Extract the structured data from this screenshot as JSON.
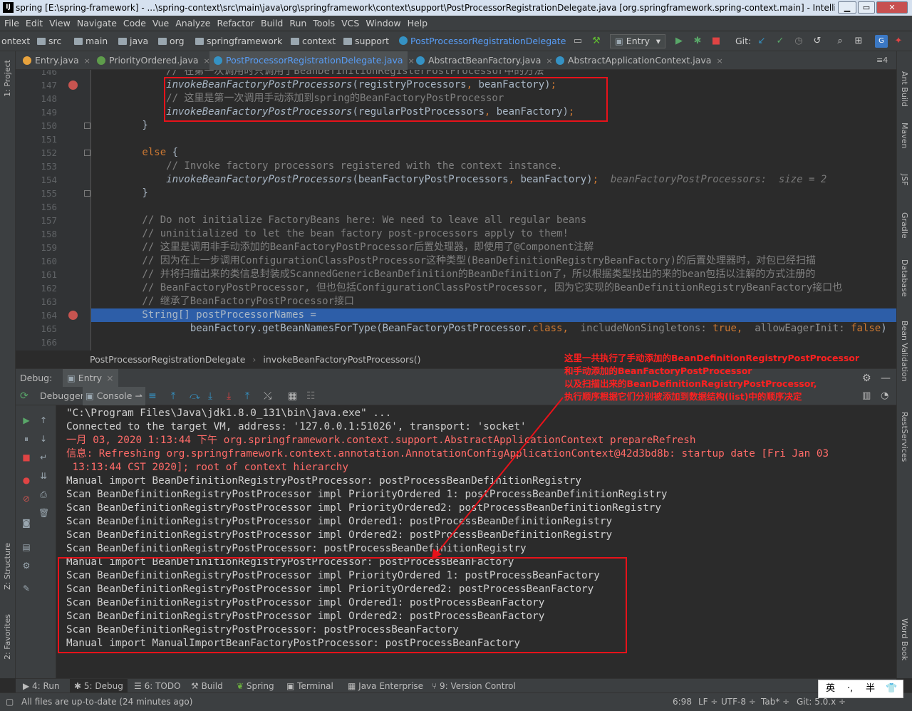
{
  "window": {
    "title": "spring [E:\\spring-framework] - ...\\spring-context\\src\\main\\java\\org\\springframework\\context\\support\\PostProcessorRegistrationDelegate.java [org.springframework.spring-context.main] - IntelliJ IDE...",
    "app_icon": "IJ"
  },
  "menu": [
    "File",
    "Edit",
    "View",
    "Navigate",
    "Code",
    "Vue",
    "Analyze",
    "Refactor",
    "Build",
    "Run",
    "Tools",
    "VCS",
    "Window",
    "Help"
  ],
  "nav": {
    "crumbs": [
      "ontext",
      "src",
      "main",
      "java",
      "org",
      "springframework",
      "context",
      "support",
      "PostProcessorRegistrationDelegate"
    ],
    "run_config": "Entry",
    "git_label": "Git:"
  },
  "tabs": [
    {
      "label": "Entry.java",
      "icon_color": "#e8a33d",
      "active": false
    },
    {
      "label": "PriorityOrdered.java",
      "icon_color": "#5e9c4b",
      "active": false
    },
    {
      "label": "PostProcessorRegistrationDelegate.java",
      "icon_color": "#3592c4",
      "active": true
    },
    {
      "label": "AbstractBeanFactory.java",
      "icon_color": "#3592c4",
      "active": false
    },
    {
      "label": "AbstractApplicationContext.java",
      "icon_color": "#3592c4",
      "active": false
    }
  ],
  "tab_overflow": "≡4",
  "left_tools": [
    "1: Project",
    "Z: Structure",
    "2: Favorites"
  ],
  "right_tools": [
    "Ant Build",
    "Maven",
    "JSF",
    "Gradle",
    "Database",
    "Bean Validation",
    "RestServices",
    "Word Book"
  ],
  "editor": {
    "lines": [
      {
        "n": "146",
        "segs": [
          {
            "c": "cm",
            "t": "            // 在第一次调用时只调用了BeanDefinitionRegisterPostProcessor中的方法"
          }
        ]
      },
      {
        "n": "147",
        "bp": true,
        "segs": [
          {
            "c": "fn",
            "t": "            invokeBeanFactoryPostProcessors"
          },
          {
            "c": "",
            "t": "(registryProcessors"
          },
          {
            "c": "kw",
            "t": ", "
          },
          {
            "c": "",
            "t": "beanFactory)"
          },
          {
            "c": "kw",
            "t": ";"
          }
        ]
      },
      {
        "n": "148",
        "segs": [
          {
            "c": "cm",
            "t": "            // 这里是第一次调用手动添加到spring的BeanFactoryPostProcessor"
          }
        ]
      },
      {
        "n": "149",
        "segs": [
          {
            "c": "fn",
            "t": "            invokeBeanFactoryPostProcessors"
          },
          {
            "c": "",
            "t": "(regularPostProcessors"
          },
          {
            "c": "kw",
            "t": ", "
          },
          {
            "c": "",
            "t": "beanFactory)"
          },
          {
            "c": "kw",
            "t": ";"
          }
        ]
      },
      {
        "n": "150",
        "segs": [
          {
            "c": "",
            "t": "        }"
          }
        ]
      },
      {
        "n": "151",
        "segs": [
          {
            "c": "",
            "t": ""
          }
        ]
      },
      {
        "n": "152",
        "segs": [
          {
            "c": "kw",
            "t": "        else "
          },
          {
            "c": "",
            "t": "{"
          }
        ]
      },
      {
        "n": "153",
        "segs": [
          {
            "c": "cm",
            "t": "            // Invoke factory processors registered with the context instance."
          }
        ]
      },
      {
        "n": "154",
        "segs": [
          {
            "c": "fn",
            "t": "            invokeBeanFactoryPostProcessors"
          },
          {
            "c": "",
            "t": "(beanFactoryPostProcessors"
          },
          {
            "c": "kw",
            "t": ", "
          },
          {
            "c": "",
            "t": "beanFactory)"
          },
          {
            "c": "kw",
            "t": ";"
          },
          {
            "c": "hint",
            "t": "  beanFactoryPostProcessors:  size = 2"
          }
        ]
      },
      {
        "n": "155",
        "segs": [
          {
            "c": "",
            "t": "        }"
          }
        ]
      },
      {
        "n": "156",
        "segs": [
          {
            "c": "",
            "t": ""
          }
        ]
      },
      {
        "n": "157",
        "segs": [
          {
            "c": "cm",
            "t": "        // Do not initialize FactoryBeans here: We need to leave all regular beans"
          }
        ]
      },
      {
        "n": "158",
        "segs": [
          {
            "c": "cm",
            "t": "        // uninitialized to let the bean factory post-processors apply to them!"
          }
        ]
      },
      {
        "n": "159",
        "segs": [
          {
            "c": "cm",
            "t": "        // 这里是调用非手动添加的BeanFactoryPostProcessor后置处理器，即使用了@Component注解"
          }
        ]
      },
      {
        "n": "160",
        "segs": [
          {
            "c": "cm",
            "t": "        // 因为在上一步调用ConfigurationClassPostProcessor这种类型(BeanDefinitionRegistryBeanFactory)的后置处理器时，对包已经扫描"
          }
        ]
      },
      {
        "n": "161",
        "segs": [
          {
            "c": "cm",
            "t": "        // 并将扫描出来的类信息封装成ScannedGenericBeanDefinition的BeanDefinition了，所以根据类型找出的来的bean包括以注解的方式注册的"
          }
        ]
      },
      {
        "n": "162",
        "segs": [
          {
            "c": "cm",
            "t": "        // BeanFactoryPostProcessor, 但也包括ConfigurationClassPostProcessor, 因为它实现的BeanDefinitionRegistryBeanFactory接口也"
          }
        ]
      },
      {
        "n": "163",
        "segs": [
          {
            "c": "cm",
            "t": "        // 继承了BeanFactoryPostProcessor接口"
          }
        ]
      },
      {
        "n": "164",
        "bp": true,
        "hl": true,
        "segs": [
          {
            "c": "",
            "t": "        String[] postProcessorNames ="
          }
        ]
      },
      {
        "n": "165",
        "segs": [
          {
            "c": "",
            "t": "                beanFactory.getBeanNamesForType(BeanFactoryPostProcessor."
          },
          {
            "c": "kw",
            "t": "class"
          },
          {
            "c": "kw",
            "t": ", "
          },
          {
            "c": "hintplain",
            "t": " includeNonSingletons: "
          },
          {
            "c": "kw",
            "t": "true"
          },
          {
            "c": "kw",
            "t": ", "
          },
          {
            "c": "hintplain",
            "t": " allowEagerInit: "
          },
          {
            "c": "kw",
            "t": "false"
          },
          {
            "c": "",
            "t": ")"
          }
        ]
      },
      {
        "n": "166",
        "segs": [
          {
            "c": "",
            "t": ""
          }
        ]
      }
    ]
  },
  "editor_crumb": {
    "cls": "PostProcessorRegistrationDelegate",
    "method": "invokeBeanFactoryPostProcessors()"
  },
  "debug": {
    "label": "Debug:",
    "config": "Entry",
    "debugger_tab": "Debugger",
    "console_tab": "Console"
  },
  "console": [
    {
      "c": "",
      "t": "\"C:\\Program Files\\Java\\jdk1.8.0_131\\bin\\java.exe\" ..."
    },
    {
      "c": "",
      "t": "Connected to the target VM, address: '127.0.0.1:51026', transport: 'socket'"
    },
    {
      "c": "red",
      "t": "一月 03, 2020 1:13:44 下午 org.springframework.context.support.AbstractApplicationContext prepareRefresh"
    },
    {
      "c": "red",
      "t": "信息: Refreshing org.springframework.context.annotation.AnnotationConfigApplicationContext@42d3bd8b: startup date [Fri Jan 03"
    },
    {
      "c": "red",
      "t": " 13:13:44 CST 2020]; root of context hierarchy"
    },
    {
      "c": "",
      "t": "Manual import BeanDefinitionRegistryPostProcessor: postProcessBeanDefinitionRegistry"
    },
    {
      "c": "",
      "t": "Scan BeanDefinitionRegistryPostProcessor impl PriorityOrdered 1: postProcessBeanDefinitionRegistry"
    },
    {
      "c": "",
      "t": "Scan BeanDefinitionRegistryPostProcessor impl PriorityOrdered2: postProcessBeanDefinitionRegistry"
    },
    {
      "c": "",
      "t": "Scan BeanDefinitionRegistryPostProcessor impl Ordered1: postProcessBeanDefinitionRegistry"
    },
    {
      "c": "",
      "t": "Scan BeanDefinitionRegistryPostProcessor impl Ordered2: postProcessBeanDefinitionRegistry"
    },
    {
      "c": "",
      "t": "Scan BeanDefinitionRegistryPostProcessor: postProcessBeanDefinitionRegistry"
    },
    {
      "c": "",
      "t": "Manual import BeanDefinitionRegistryPostProcessor: postProcessBeanFactory"
    },
    {
      "c": "",
      "t": "Scan BeanDefinitionRegistryPostProcessor impl PriorityOrdered 1: postProcessBeanFactory"
    },
    {
      "c": "",
      "t": "Scan BeanDefinitionRegistryPostProcessor impl PriorityOrdered2: postProcessBeanFactory"
    },
    {
      "c": "",
      "t": "Scan BeanDefinitionRegistryPostProcessor impl Ordered1: postProcessBeanFactory"
    },
    {
      "c": "",
      "t": "Scan BeanDefinitionRegistryPostProcessor impl Ordered2: postProcessBeanFactory"
    },
    {
      "c": "",
      "t": "Scan BeanDefinitionRegistryPostProcessor: postProcessBeanFactory"
    },
    {
      "c": "",
      "t": "Manual import ManualImportBeanFactoryPostProcessor: postProcessBeanFactory"
    }
  ],
  "annotation": [
    "这里一共执行了手动添加的BeanDefinitionRegistryPostProcessor",
    "和手动添加的BeanFactoryPostProcessor",
    "以及扫描出来的BeanDefinitionRegistryPostProcessor,",
    "执行顺序根据它们分别被添加到数据结构(list)中的顺序决定"
  ],
  "tool_windows": [
    "4: Run",
    "5: Debug",
    "6: TODO",
    "Build",
    "Spring",
    "Terminal",
    "Java Enterprise",
    "9: Version Control"
  ],
  "status": {
    "message": "All files are up-to-date (24 minutes ago)",
    "position": "6:98",
    "line_sep": "LF ÷",
    "encoding": "UTF-8 ÷",
    "indent": "Tab* ÷",
    "git": "Git: 5.0.x ÷"
  },
  "ime": [
    "英",
    "·,",
    "半",
    "👕"
  ],
  "colors": {
    "annotation_red": "#e8121a",
    "highlight_line": "#2d5ea8",
    "accent": "#589df6"
  }
}
